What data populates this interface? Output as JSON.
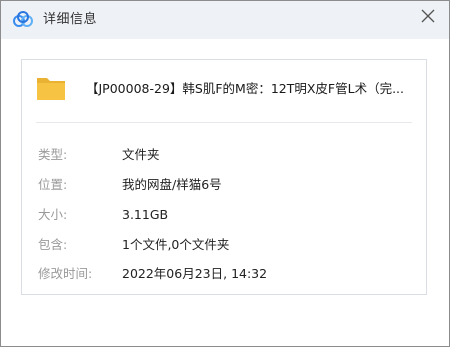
{
  "window": {
    "title": "详细信息",
    "app_icon": "cloud-icon",
    "close_icon": "close-icon"
  },
  "file": {
    "icon": "folder-icon",
    "name": "【JP00008-29】韩S肌F的M密：12T明X皮F管L术（完..."
  },
  "properties": [
    {
      "label": "类型:",
      "value": "文件夹"
    },
    {
      "label": "位置:",
      "value": "我的网盘/样猫6号"
    },
    {
      "label": "大小:",
      "value": "3.11GB"
    },
    {
      "label": "包含:",
      "value": "1个文件,0个文件夹"
    },
    {
      "label": "修改时间:",
      "value": "2022年06月23日, 14:32"
    }
  ],
  "colors": {
    "folder": "#f6c343",
    "cloud_blue": "#3b8cf0",
    "label": "#9a9a9a",
    "value": "#222222"
  }
}
